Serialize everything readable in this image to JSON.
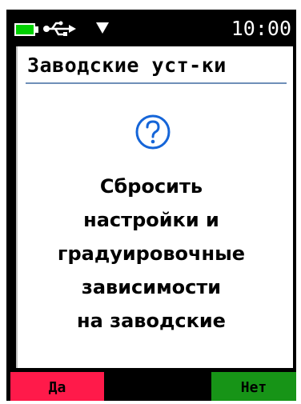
{
  "status": {
    "time": "10:00",
    "battery_icon": "battery-icon",
    "usb_icon": "usb-icon",
    "signal_icon": "signal-icon"
  },
  "screen": {
    "title": "Заводские уст-ки",
    "icon": "question-icon",
    "message_lines": [
      "Сбросить",
      "настройки и",
      "градуировочные",
      "зависимости",
      "на заводские"
    ]
  },
  "buttons": {
    "yes": "Да",
    "no": "Нет"
  },
  "colors": {
    "yes": "#ff1a4a",
    "no": "#179417",
    "icon": "#1565d8",
    "battery": "#00d000"
  }
}
